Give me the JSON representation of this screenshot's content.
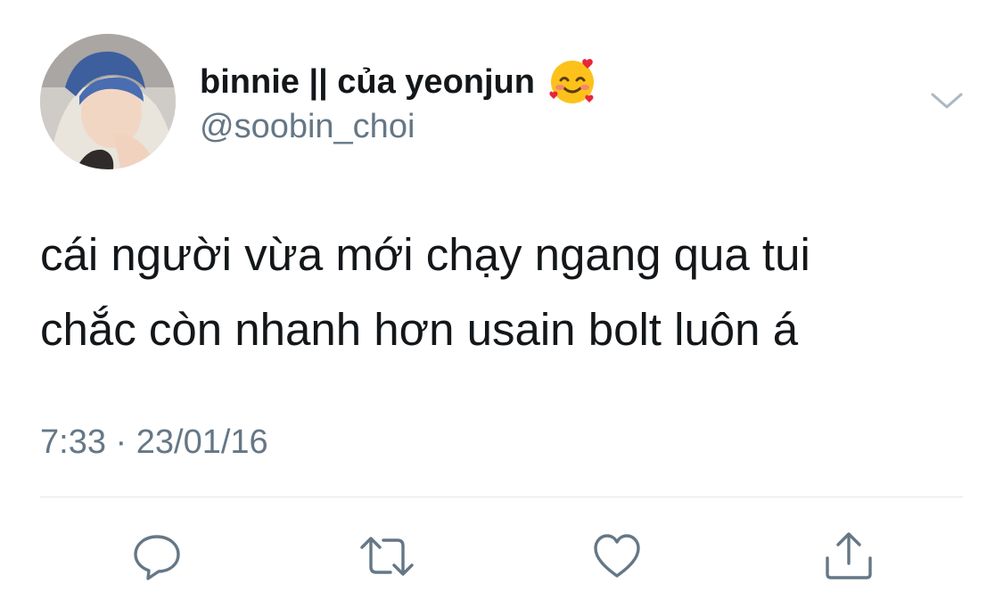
{
  "tweet": {
    "author": {
      "display_name": "binnie || của yeonjun",
      "handle": "@soobin_choi",
      "emoji": "smiling-face-with-hearts-icon"
    },
    "text_lines": [
      "cái người vừa mới chạy ngang qua tui",
      "chắc còn nhanh hơn usain bolt luôn á"
    ],
    "time": "7:33",
    "separator": "·",
    "date": "23/01/16"
  },
  "actions": [
    {
      "name": "reply",
      "icon": "reply-icon"
    },
    {
      "name": "retweet",
      "icon": "retweet-icon"
    },
    {
      "name": "like",
      "icon": "heart-icon"
    },
    {
      "name": "share",
      "icon": "share-icon"
    }
  ],
  "colors": {
    "text_primary": "#14171a",
    "text_secondary": "#657786",
    "divider": "#e1e8ed",
    "icon": "#657786"
  }
}
